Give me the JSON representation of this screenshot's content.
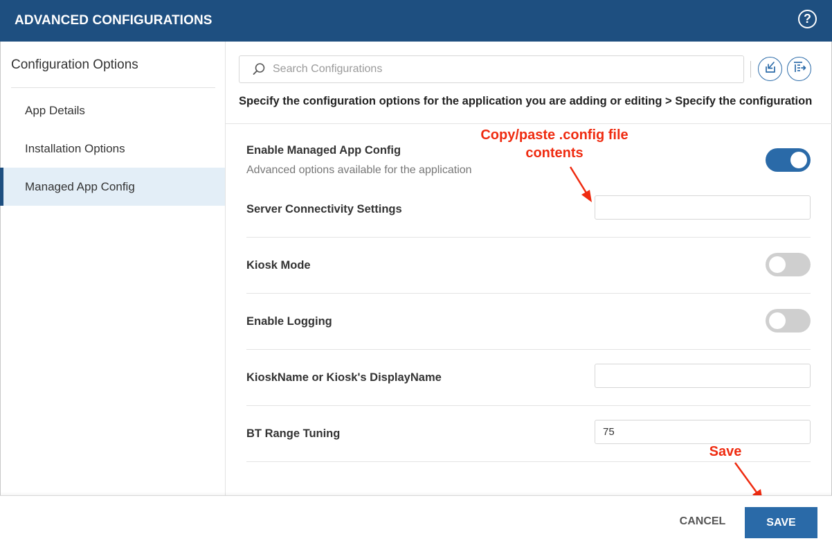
{
  "header": {
    "title": "ADVANCED CONFIGURATIONS",
    "help_icon": "question-circle-icon",
    "help_glyph": "?"
  },
  "sidebar": {
    "title": "Configuration Options",
    "items": [
      {
        "label": "App Details",
        "active": false
      },
      {
        "label": "Installation Options",
        "active": false
      },
      {
        "label": "Managed App Config",
        "active": true
      }
    ]
  },
  "search": {
    "placeholder": "Search Configurations",
    "value": "",
    "icon": "search-icon"
  },
  "toolbar": {
    "import_icon": "import-icon",
    "export_icon": "export-list-icon"
  },
  "breadcrumb": {
    "part1": "Specify the configuration options for the application you are adding or editing",
    "separator": ">",
    "part2": "Specify the configuration options"
  },
  "settings": {
    "managed_app_config": {
      "label": "Enable Managed App Config",
      "description": "Advanced options available for the application",
      "enabled": true
    },
    "server_connectivity": {
      "label": "Server Connectivity Settings",
      "value": ""
    },
    "kiosk_mode": {
      "label": "Kiosk Mode",
      "enabled": false
    },
    "enable_logging": {
      "label": "Enable Logging",
      "enabled": false
    },
    "kiosk_name": {
      "label": "KioskName or Kiosk's DisplayName",
      "value": ""
    },
    "bt_range": {
      "label": "BT Range Tuning",
      "value": "75"
    }
  },
  "annotations": {
    "config_note_line1": "Copy/paste .config file",
    "config_note_line2": "contents",
    "save_note": "Save",
    "color": "#ef2b10"
  },
  "footer": {
    "cancel_label": "CANCEL",
    "save_label": "SAVE"
  },
  "colors": {
    "header_bg": "#1e4f80",
    "accent": "#2a6aa8",
    "active_item_bg": "#e3eef7"
  }
}
